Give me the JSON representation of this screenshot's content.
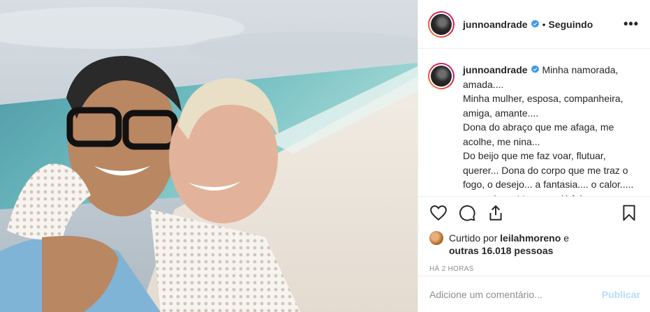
{
  "post": {
    "username": "junnoandrade",
    "follow_status": "Seguindo",
    "separator": "•",
    "more_label": "•••",
    "caption": {
      "username": "junnoandrade",
      "text": "Minha namorada, amada....\nMinha mulher, esposa, companheira, amiga, amante....\nDona do abraço que me afaga, me acolhe, me nina...\nDo beijo que me faz voar, flutuar, querer... Dona do corpo que me traz o fogo, o desejo... a fantasia.... o calor..... o arrepio..... Voce que já foi meu"
    },
    "likes": {
      "prefix": "Curtido por",
      "liker": "leilahmoreno",
      "conjunction": "e",
      "others": "outras 16.018 pessoas"
    },
    "timestamp": "HÁ 2 HORAS",
    "comment": {
      "placeholder": "Adicione um comentário...",
      "value": "",
      "publish_label": "Publicar"
    }
  },
  "icons": {
    "like": "heart-icon",
    "comment": "comment-icon",
    "share": "share-icon",
    "save": "bookmark-icon",
    "verified": "verified-badge-icon",
    "options": "more-options-icon"
  },
  "colors": {
    "text": "#262626",
    "muted": "#8e8e8e",
    "verified": "#3897f0",
    "publish_disabled": "#b3dbff",
    "border": "#efefef"
  }
}
